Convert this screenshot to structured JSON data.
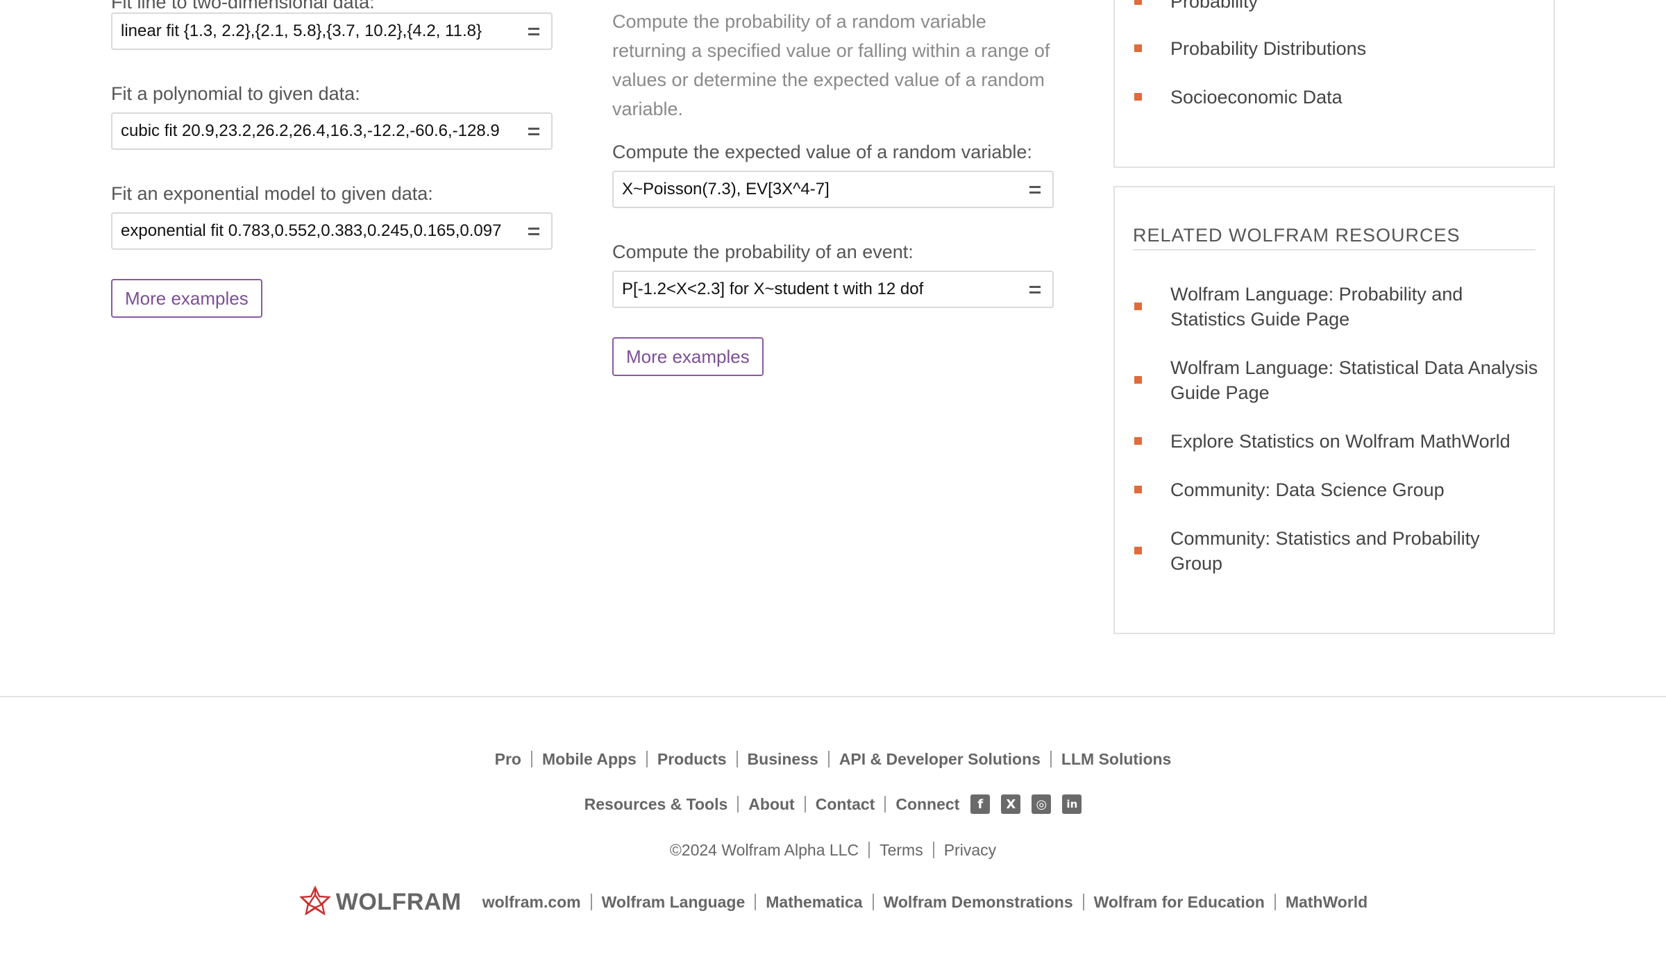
{
  "left": {
    "fit_line_label": "Fit line to two-dimensional data:",
    "fit_line_value": "linear fit {1.3, 2.2},{2.1, 5.8},{3.7, 10.2},{4.2, 11.8}",
    "poly_label": "Fit a polynomial to given data:",
    "poly_value": "cubic fit 20.9,23.2,26.2,26.4,16.3,-12.2,-60.6,-128.9",
    "exp_label": "Fit an exponential model to given data:",
    "exp_value": "exponential fit 0.783,0.552,0.383,0.245,0.165,0.097",
    "more": "More examples"
  },
  "middle": {
    "description": "Compute the probability of a random variable returning a specified value or falling within a range of values or determine the expected value of a random variable.",
    "expected_label": "Compute the expected value of a random variable:",
    "expected_value": "X~Poisson(7.3), EV[3X^4-7]",
    "event_label": "Compute the probability of an event:",
    "event_value": "P[-1.2<X<2.3] for X~student t with 12 dof",
    "more": "More examples"
  },
  "topics": [
    "Probability",
    "Probability Distributions",
    "Socioeconomic Data"
  ],
  "resources": {
    "heading": "RELATED WOLFRAM RESOURCES",
    "items": [
      [
        "Wolfram Language: Probability and",
        "Statistics Guide Page"
      ],
      [
        "Wolfram Language: Statistical Data Analysis",
        "Guide Page"
      ],
      [
        "Explore Statistics on Wolfram MathWorld"
      ],
      [
        "Community: Data Science Group"
      ],
      [
        "Community: Statistics and Probability",
        "Group"
      ]
    ]
  },
  "footer": {
    "row1": [
      "Pro",
      "Mobile Apps",
      "Products",
      "Business",
      "API & Developer Solutions",
      "LLM Solutions"
    ],
    "row2": [
      "Resources & Tools",
      "About",
      "Contact",
      "Connect"
    ],
    "social": [
      {
        "name": "facebook-icon",
        "glyph": "f"
      },
      {
        "name": "x-icon",
        "glyph": "X"
      },
      {
        "name": "instagram-icon",
        "glyph": "◎"
      },
      {
        "name": "linkedin-icon",
        "glyph": "in"
      }
    ],
    "copyright": "©2024  Wolfram Alpha LLC",
    "legal": [
      "Terms",
      "Privacy"
    ],
    "logo_text": "WOLFRAM",
    "row4": [
      "wolfram.com",
      "Wolfram Language",
      "Mathematica",
      "Wolfram Demonstrations",
      "Wolfram for Education",
      "MathWorld"
    ],
    "colors": {
      "accent": "#e06b3b",
      "link_purple": "#7d4f96",
      "logo_red": "#c8322f"
    }
  }
}
